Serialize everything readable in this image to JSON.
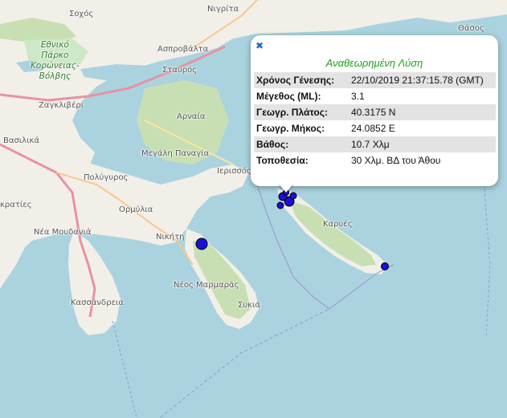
{
  "map": {
    "places": [
      {
        "id": "sochos",
        "label": "Σοχός"
      },
      {
        "id": "nigrita",
        "label": "Νιγρίτα"
      },
      {
        "id": "thasos",
        "label": "Θάσος"
      },
      {
        "id": "ethniko",
        "lines": [
          "Εθνικό",
          "Πάρκο",
          "Κορώνειας-",
          "Βόλβης"
        ]
      },
      {
        "id": "asprovalta",
        "label": "Ασπροβάλτα"
      },
      {
        "id": "stavros",
        "label": "Σταυρός"
      },
      {
        "id": "zagkliveri",
        "label": "Ζαγκλιβέρι"
      },
      {
        "id": "arnaia",
        "label": "Αρναία"
      },
      {
        "id": "vasilika",
        "label": "Βασιλικά"
      },
      {
        "id": "megali_panagia",
        "label": "Μεγάλη Παναγία"
      },
      {
        "id": "polygyros",
        "label": "Πολύγυρος"
      },
      {
        "id": "ierissos",
        "label": "Ιερισσός"
      },
      {
        "id": "kraties",
        "label": "κρατίες"
      },
      {
        "id": "ormylia",
        "label": "Ορμύλια"
      },
      {
        "id": "nea_moudania",
        "label": "Νέα Μουδανιά"
      },
      {
        "id": "nikiti",
        "label": "Νικήτη"
      },
      {
        "id": "karyes",
        "label": "Καρυές"
      },
      {
        "id": "neos_marmaras",
        "label": "Νέος Μαρμαράς"
      },
      {
        "id": "sykia",
        "label": "Συκιά"
      },
      {
        "id": "kassandreia",
        "label": "Κασσάνδρεια"
      }
    ]
  },
  "markers": [
    {
      "id": "large-nikiti",
      "size": "large",
      "color": "#1c0fd6"
    },
    {
      "id": "cluster-1",
      "size": "medium",
      "color": "#1c0fd6"
    },
    {
      "id": "cluster-2",
      "size": "medium",
      "color": "#1c0fd6"
    },
    {
      "id": "cluster-3",
      "size": "small",
      "color": "#1c0fd6"
    },
    {
      "id": "cluster-4",
      "size": "small",
      "color": "#1c0fd6"
    },
    {
      "id": "cluster-5",
      "size": "small",
      "color": "#1c0fd6"
    },
    {
      "id": "east-athos",
      "size": "small",
      "color": "#1c0fd6"
    }
  ],
  "popup": {
    "close_label": "✖",
    "title": "Αναθεωρημένη Λύση",
    "rows": [
      {
        "key": "Χρόνος Γένεσης:",
        "value": "22/10/2019 21:37:15.78 (GMT)"
      },
      {
        "key": "Μέγεθος (ML):",
        "value": "3.1"
      },
      {
        "key": "Γεωγρ. Πλάτος:",
        "value": "40.3175 N"
      },
      {
        "key": "Γεωγρ. Μήκος:",
        "value": "24.0852 E"
      },
      {
        "key": "Βάθος:",
        "value": "10.7 Χλμ"
      },
      {
        "key": "Τοποθεσία:",
        "value": "30 Χλμ. ΒΔ του Άθου"
      }
    ]
  }
}
